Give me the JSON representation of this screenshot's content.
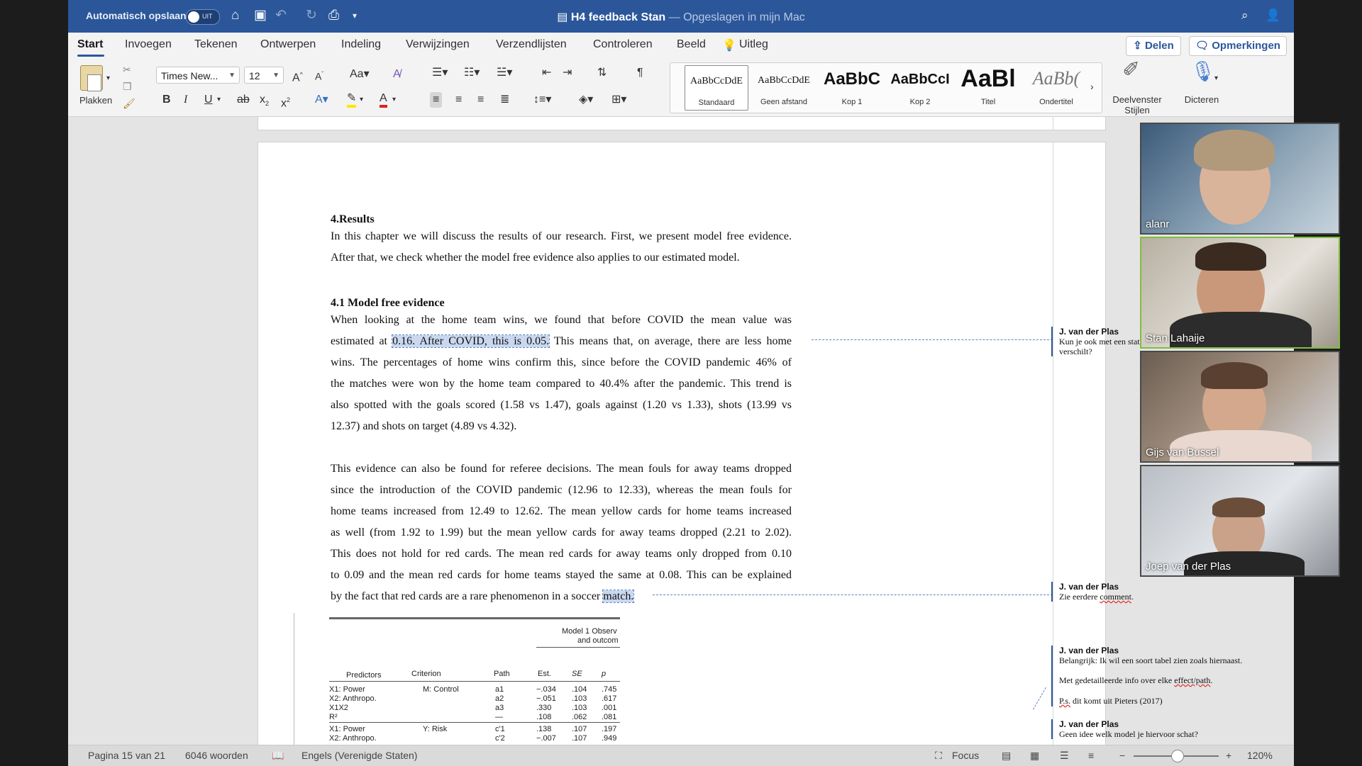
{
  "titlebar": {
    "autosave_label": "Automatisch opslaan",
    "autosave_state": "UIT",
    "doc_title": "H4 feedback Stan",
    "doc_status": "— Opgeslagen in mijn Mac"
  },
  "tabs": [
    "Start",
    "Invoegen",
    "Tekenen",
    "Ontwerpen",
    "Indeling",
    "Verwijzingen",
    "Verzendlijsten",
    "Controleren",
    "Beeld"
  ],
  "tell_me": "Uitleg",
  "share_label": "Delen",
  "comments_label": "Opmerkingen",
  "ribbon": {
    "paste_label": "Plakken",
    "font_name": "Times New...",
    "font_size": "12",
    "styles": [
      {
        "preview": "AaBbCcDdE",
        "name": "Standaard"
      },
      {
        "preview": "AaBbCcDdE",
        "name": "Geen afstand"
      },
      {
        "preview": "AaBbC",
        "name": "Kop 1"
      },
      {
        "preview": "AaBbCcI",
        "name": "Kop 2"
      },
      {
        "preview": "AaBl",
        "name": "Titel"
      },
      {
        "preview": "AaBb(",
        "name": "Ondertitel"
      }
    ],
    "styles_pane_label_1": "Deelvenster",
    "styles_pane_label_2": "Stijlen",
    "dictate_label": "Dicteren"
  },
  "document": {
    "heading_results": "4.Results",
    "intro_lines": [
      "In this chapter we will discuss the results of our research. First, we present model free evidence.",
      "After that, we check whether the model free evidence also applies to our estimated model."
    ],
    "heading_model_free": "4.1 Model free evidence",
    "p1_line1": "When looking at the home team wins, we found that before COVID the mean value was",
    "p1_line2_pre": "estimated at ",
    "p1_line2_hl": "0.16. After COVID, this is 0.05.",
    "p1_line2_post": " This means that, on average, there are less home",
    "p1_lines_rest": [
      "wins. The percentages of home wins confirm this, since before the COVID pandemic 46% of",
      "the matches were won by the home team compared to 40.4% after the pandemic. This trend is",
      "also spotted with the goals scored (1.58 vs 1.47), goals against (1.20 vs 1.33), shots (13.99 vs",
      "12.37) and shots on target (4.89 vs 4.32)."
    ],
    "p2_lines": [
      "This evidence can also be found for referee decisions. The mean fouls for away teams dropped",
      "since the introduction of the COVID pandemic (12.96 to 12.33), whereas the mean fouls for",
      "home teams increased from 12.49 to 12.62. The mean yellow cards for home teams increased",
      "as well (from 1.92 to 1.99) but the mean yellow cards for away teams dropped (2.21 to 2.02).",
      "This does not hold for red cards. The mean red cards for away teams only dropped from 0.10",
      "to 0.09 and the mean red cards for home teams stayed the same at 0.08. This can be explained"
    ],
    "p2_last_pre": "by the fact that red cards are a rare phenomenon in a soccer ",
    "p2_last_hl": "match."
  },
  "comments": [
    {
      "author": "J. van der Plas",
      "text": "Kun je ook met een statistische test laten zien dat dit verschilt?"
    },
    {
      "author": "J. van der Plas",
      "text_pre": "Zie eerdere ",
      "text_err": "comment",
      "text_post": "."
    },
    {
      "author": "J. van der Plas",
      "text": "Belangrijk: Ik wil een soort tabel zien zoals hiernaast.",
      "text2_pre": "Met gedetailleerde info over elke ",
      "text2_err": "effect/path",
      "text2_post": ".",
      "text3_err": "P.s.",
      "text3_post": " dit komt uit Pieters (2017)"
    },
    {
      "author": "J. van der Plas",
      "text": "Geen idee welk model je hiervoor schat?"
    }
  ],
  "table": {
    "title_1": "Model 1 Observ",
    "title_2": "and outcom",
    "headers": [
      "Predictors",
      "Criterion",
      "Path",
      "Est.",
      "SE",
      "p"
    ],
    "rows": [
      [
        "X1: Power",
        "M: Control",
        "a1",
        "−.034",
        ".104",
        ".745"
      ],
      [
        "X2: Anthropo.",
        "",
        "a2",
        "−.051",
        ".103",
        ".617"
      ],
      [
        "X1X2",
        "",
        "a3",
        ".330",
        ".103",
        ".001"
      ],
      [
        "R²",
        "",
        "—",
        ".108",
        ".062",
        ".081"
      ],
      [
        "X1: Power",
        "Y: Risk",
        "c'1",
        ".138",
        ".107",
        ".197"
      ],
      [
        "X2: Anthropo.",
        "",
        "c'2",
        "−.007",
        ".107",
        ".949"
      ]
    ]
  },
  "statusbar": {
    "page": "Pagina 15 van 21",
    "words": "6046 woorden",
    "language": "Engels (Verenigde Staten)",
    "focus": "Focus",
    "zoom": "120%"
  },
  "participants": [
    "alanr",
    "Stan Lahaije",
    "Gijs van Bussel",
    "Joep van der Plas"
  ],
  "colors": {
    "accent": "#2b579a",
    "highlight": "#c9d8ef"
  }
}
